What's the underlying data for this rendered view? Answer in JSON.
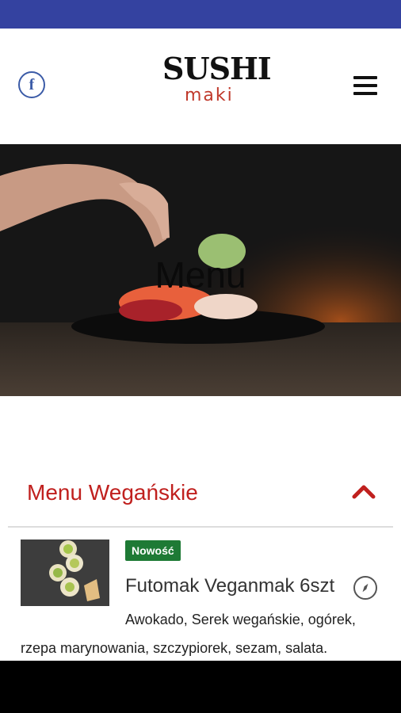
{
  "header": {
    "facebook_glyph": "f",
    "logo_top": "SUSHI",
    "logo_bottom": "maki"
  },
  "hero": {
    "title": "Menu"
  },
  "section": {
    "title": "Menu Wegańskie",
    "accent_color": "#c0201e"
  },
  "items": [
    {
      "badge": "Nowość",
      "name": "Futomak Veganmak 6szt",
      "description_line1": "Awokado, Serek wegańskie, ogórek,",
      "description_line2": "rzepa marynowania, szczypiorek, sezam, salata.",
      "badge_color": "#1e7a35"
    }
  ],
  "colors": {
    "status_bar": "#3442a0",
    "facebook": "#3b5ba7"
  }
}
